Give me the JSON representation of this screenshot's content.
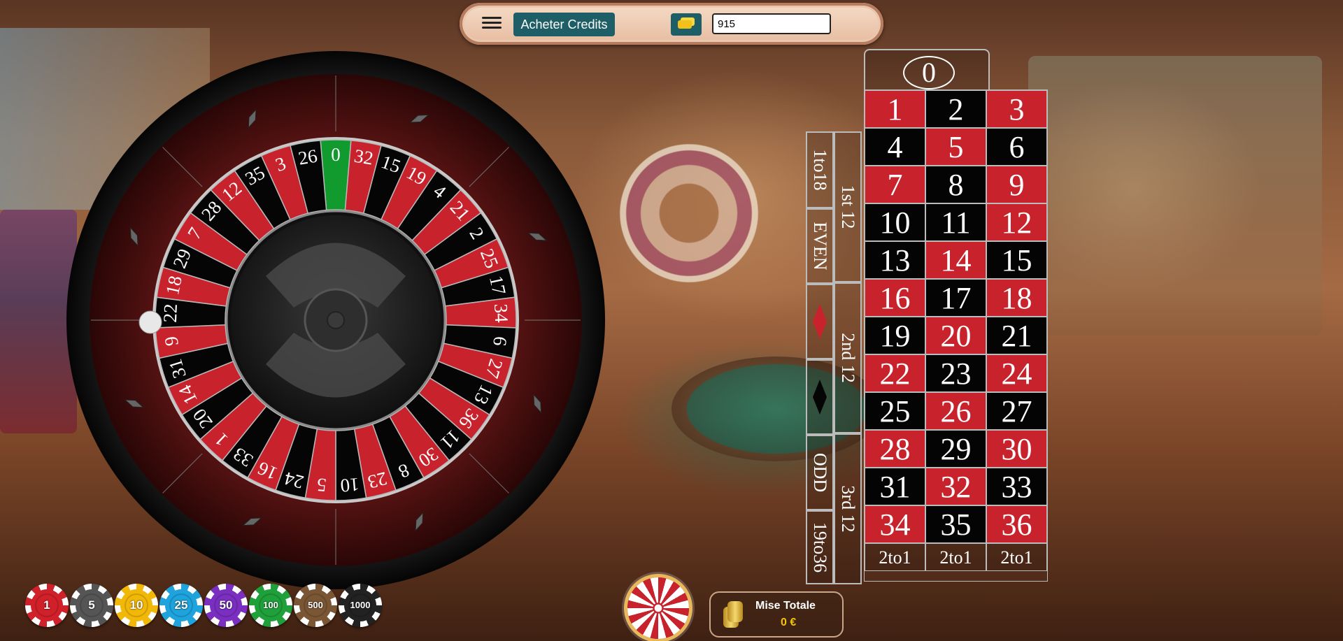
{
  "topbar": {
    "menu_icon": "hamburger-menu-icon",
    "buy_credits_label": "Acheter Credits",
    "coin_icon": "coin-stack-icon",
    "credits_value": "915"
  },
  "wheel": {
    "sequence": [
      "0",
      "32",
      "15",
      "19",
      "4",
      "21",
      "2",
      "25",
      "17",
      "34",
      "6",
      "27",
      "13",
      "36",
      "11",
      "30",
      "8",
      "23",
      "10",
      "5",
      "24",
      "16",
      "33",
      "1",
      "20",
      "14",
      "31",
      "9",
      "22",
      "18",
      "29",
      "7",
      "28",
      "12",
      "35",
      "3",
      "26"
    ],
    "colors": {
      "red": "#c8232c",
      "black": "#050505",
      "green": "#119a2e"
    }
  },
  "table": {
    "zero": "0",
    "numbers": [
      {
        "n": "1",
        "c": "red"
      },
      {
        "n": "2",
        "c": "black"
      },
      {
        "n": "3",
        "c": "red"
      },
      {
        "n": "4",
        "c": "black"
      },
      {
        "n": "5",
        "c": "red"
      },
      {
        "n": "6",
        "c": "black"
      },
      {
        "n": "7",
        "c": "red"
      },
      {
        "n": "8",
        "c": "black"
      },
      {
        "n": "9",
        "c": "red"
      },
      {
        "n": "10",
        "c": "black"
      },
      {
        "n": "11",
        "c": "black"
      },
      {
        "n": "12",
        "c": "red"
      },
      {
        "n": "13",
        "c": "black"
      },
      {
        "n": "14",
        "c": "red"
      },
      {
        "n": "15",
        "c": "black"
      },
      {
        "n": "16",
        "c": "red"
      },
      {
        "n": "17",
        "c": "black"
      },
      {
        "n": "18",
        "c": "red"
      },
      {
        "n": "19",
        "c": "black"
      },
      {
        "n": "20",
        "c": "red"
      },
      {
        "n": "21",
        "c": "black"
      },
      {
        "n": "22",
        "c": "red"
      },
      {
        "n": "23",
        "c": "black"
      },
      {
        "n": "24",
        "c": "red"
      },
      {
        "n": "25",
        "c": "black"
      },
      {
        "n": "26",
        "c": "red"
      },
      {
        "n": "27",
        "c": "black"
      },
      {
        "n": "28",
        "c": "red"
      },
      {
        "n": "29",
        "c": "black"
      },
      {
        "n": "30",
        "c": "red"
      },
      {
        "n": "31",
        "c": "black"
      },
      {
        "n": "32",
        "c": "red"
      },
      {
        "n": "33",
        "c": "black"
      },
      {
        "n": "34",
        "c": "red"
      },
      {
        "n": "35",
        "c": "black"
      },
      {
        "n": "36",
        "c": "red"
      }
    ],
    "columns": [
      "2to1",
      "2to1",
      "2to1"
    ],
    "dozens": [
      "1st 12",
      "2nd 12",
      "3rd 12"
    ],
    "outside": {
      "low": "1to18",
      "even": "EVEN",
      "red_icon": "red-diamond-icon",
      "black_icon": "black-diamond-icon",
      "odd": "ODD",
      "high": "19to36"
    }
  },
  "chips": [
    {
      "value": "1",
      "color": "#d0202a"
    },
    {
      "value": "5",
      "color": "#555555"
    },
    {
      "value": "10",
      "color": "#f2b807"
    },
    {
      "value": "25",
      "color": "#1ea3dc"
    },
    {
      "value": "50",
      "color": "#7a2fc0"
    },
    {
      "value": "100",
      "color": "#1fa03a"
    },
    {
      "value": "500",
      "color": "#7a5634"
    },
    {
      "value": "1000",
      "color": "#222222"
    }
  ],
  "bottom": {
    "spin_icon": "wheel-spin-icon",
    "total_bet_label": "Mise Totale",
    "total_bet_value": "0 €",
    "coins_icon": "gold-coins-icon"
  }
}
